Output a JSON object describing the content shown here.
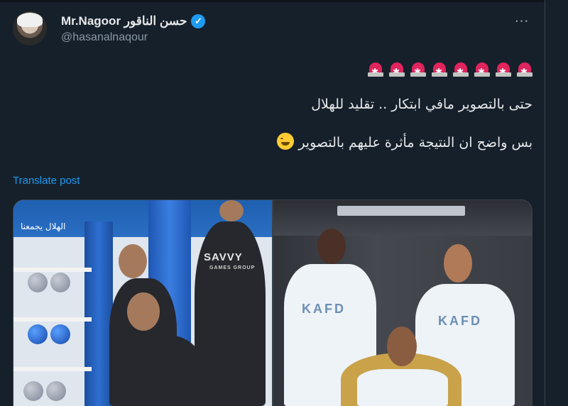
{
  "tweet": {
    "display_name": "Mr.Nagoor حسن الناقور",
    "handle": "@hasanalnaqour",
    "more_label": "⋯",
    "siren_emojis": [
      "🚨",
      "🚨",
      "🚨",
      "🚨",
      "🚨",
      "🚨",
      "🚨",
      "🚨"
    ],
    "text_line1": "حتى بالتصوير مافي ابتكار .. تقليد للهلال",
    "text_line2": "بس واضح ان النتيجة مأثرة عليهم بالتصوير",
    "translate_label": "Translate post"
  },
  "media": {
    "left_image": {
      "banner_text": "الهلال يجمعنا",
      "jersey_sponsor": "SAVVY",
      "jersey_sponsor_sub": "GAMES GROUP"
    },
    "right_image": {
      "jersey_sponsor": "KAFD"
    }
  },
  "colors": {
    "background": "#15202b",
    "link": "#1d9bf0",
    "verified": "#1d9bf0",
    "secondary_text": "#8b98a5"
  }
}
